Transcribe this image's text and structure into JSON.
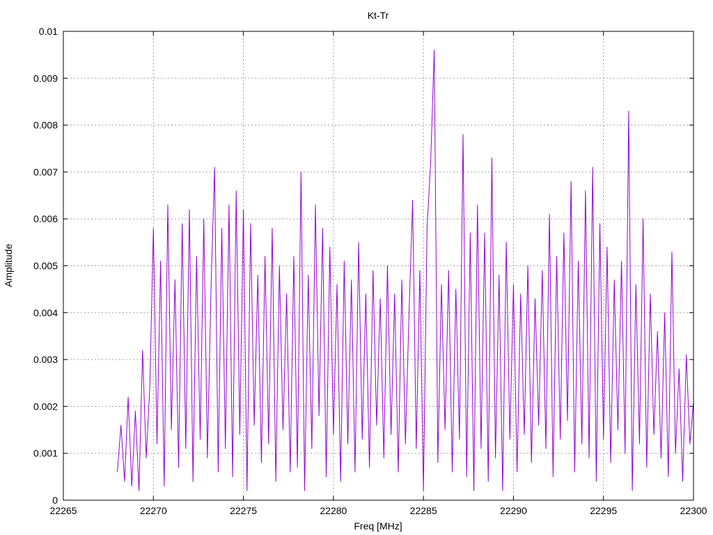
{
  "chart_data": {
    "type": "line",
    "title": "Kt-Tr",
    "xlabel": "Freq [MHz]",
    "ylabel": "Amplitude",
    "xlim": [
      22265,
      22300
    ],
    "ylim": [
      0,
      0.01
    ],
    "x_ticks": [
      22265,
      22270,
      22275,
      22280,
      22285,
      22290,
      22295,
      22300
    ],
    "x_tick_labels": [
      "22265",
      "22270",
      "22275",
      "22280",
      "22285",
      "22290",
      "22295",
      "22300"
    ],
    "y_ticks": [
      0,
      0.001,
      0.002,
      0.003,
      0.004,
      0.005,
      0.006,
      0.007,
      0.008,
      0.009,
      0.01
    ],
    "y_tick_labels": [
      "0",
      "0.001",
      "0.002",
      "0.003",
      "0.004",
      "0.005",
      "0.006",
      "0.007",
      "0.008",
      "0.009",
      "0.01"
    ],
    "grid": true,
    "series": [
      {
        "color": "#9400d3",
        "x": [
          22268.0,
          22268.2,
          22268.4,
          22268.6,
          22268.8,
          22269.0,
          22269.2,
          22269.4,
          22269.6,
          22269.8,
          22270.0,
          22270.2,
          22270.4,
          22270.6,
          22270.8,
          22271.0,
          22271.2,
          22271.4,
          22271.6,
          22271.8,
          22272.0,
          22272.2,
          22272.4,
          22272.6,
          22272.8,
          22273.0,
          22273.2,
          22273.4,
          22273.6,
          22273.8,
          22274.0,
          22274.2,
          22274.4,
          22274.6,
          22274.8,
          22275.0,
          22275.2,
          22275.4,
          22275.6,
          22275.8,
          22276.0,
          22276.2,
          22276.4,
          22276.6,
          22276.8,
          22277.0,
          22277.2,
          22277.4,
          22277.6,
          22277.8,
          22278.0,
          22278.2,
          22278.4,
          22278.6,
          22278.8,
          22279.0,
          22279.2,
          22279.4,
          22279.6,
          22279.8,
          22280.0,
          22280.2,
          22280.4,
          22280.6,
          22280.8,
          22281.0,
          22281.2,
          22281.4,
          22281.6,
          22281.8,
          22282.0,
          22282.2,
          22282.4,
          22282.6,
          22282.8,
          22283.0,
          22283.2,
          22283.4,
          22283.6,
          22283.8,
          22284.0,
          22284.2,
          22284.4,
          22284.6,
          22284.8,
          22285.0,
          22285.2,
          22285.4,
          22285.6,
          22285.8,
          22286.0,
          22286.2,
          22286.4,
          22286.6,
          22286.8,
          22287.0,
          22287.2,
          22287.4,
          22287.6,
          22287.8,
          22288.0,
          22288.2,
          22288.4,
          22288.6,
          22288.8,
          22289.0,
          22289.2,
          22289.4,
          22289.6,
          22289.8,
          22290.0,
          22290.2,
          22290.4,
          22290.6,
          22290.8,
          22291.0,
          22291.2,
          22291.4,
          22291.6,
          22291.8,
          22292.0,
          22292.2,
          22292.4,
          22292.6,
          22292.8,
          22293.0,
          22293.2,
          22293.4,
          22293.6,
          22293.8,
          22294.0,
          22294.2,
          22294.4,
          22294.6,
          22294.8,
          22295.0,
          22295.2,
          22295.4,
          22295.6,
          22295.8,
          22296.0,
          22296.2,
          22296.4,
          22296.6,
          22296.8,
          22297.0,
          22297.2,
          22297.4,
          22297.6,
          22297.8,
          22298.0,
          22298.2,
          22298.4,
          22298.6,
          22298.8,
          22299.0,
          22299.2,
          22299.4,
          22299.6,
          22299.8,
          22300.0
        ],
        "y": [
          0.0006,
          0.0016,
          0.0004,
          0.0022,
          0.0003,
          0.0019,
          0.0002,
          0.0032,
          0.0009,
          0.0024,
          0.0058,
          0.0012,
          0.0051,
          0.0003,
          0.0063,
          0.0015,
          0.0047,
          0.0007,
          0.0059,
          0.0011,
          0.0062,
          0.0004,
          0.0052,
          0.0013,
          0.006,
          0.0009,
          0.0045,
          0.0071,
          0.0006,
          0.0058,
          0.0011,
          0.0063,
          0.0005,
          0.0066,
          0.0014,
          0.0062,
          0.0002,
          0.0059,
          0.0016,
          0.0048,
          0.0008,
          0.0052,
          0.0012,
          0.0058,
          0.0004,
          0.005,
          0.0015,
          0.0044,
          0.0006,
          0.0052,
          0.0007,
          0.007,
          0.0002,
          0.0048,
          0.0011,
          0.0063,
          0.0018,
          0.0058,
          0.0005,
          0.0054,
          0.0014,
          0.0046,
          0.0004,
          0.0051,
          0.0012,
          0.0047,
          0.0006,
          0.0055,
          0.0013,
          0.0044,
          0.0007,
          0.0049,
          0.0016,
          0.0043,
          0.0009,
          0.005,
          0.0014,
          0.0044,
          0.0006,
          0.0047,
          0.0012,
          0.004,
          0.0064,
          0.0011,
          0.0049,
          0.0002,
          0.0058,
          0.0072,
          0.0096,
          0.0008,
          0.0046,
          0.0015,
          0.0049,
          0.0006,
          0.0045,
          0.0013,
          0.0078,
          0.0005,
          0.0057,
          0.0002,
          0.0063,
          0.0011,
          0.0057,
          0.0004,
          0.0073,
          0.0009,
          0.0048,
          0.0002,
          0.0055,
          0.0013,
          0.0046,
          0.0006,
          0.0044,
          0.0014,
          0.005,
          0.0008,
          0.0043,
          0.0016,
          0.0049,
          0.0011,
          0.0061,
          0.0005,
          0.0052,
          0.0013,
          0.0057,
          0.0017,
          0.0068,
          0.0006,
          0.0051,
          0.0012,
          0.0066,
          0.0009,
          0.0071,
          0.0004,
          0.0059,
          0.0013,
          0.0054,
          0.0008,
          0.0047,
          0.0015,
          0.0051,
          0.001,
          0.0083,
          0.0002,
          0.0046,
          0.0012,
          0.006,
          0.0007,
          0.0044,
          0.0014,
          0.0036,
          0.0009,
          0.004,
          0.0005,
          0.0053,
          0.001,
          0.0028,
          0.0004,
          0.0031,
          0.0012,
          0.0021
        ]
      }
    ]
  }
}
